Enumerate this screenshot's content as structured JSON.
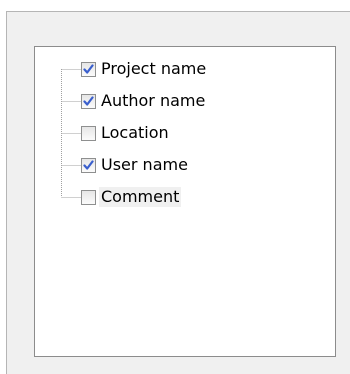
{
  "tree": {
    "items": [
      {
        "label": "Project name",
        "checked": true,
        "selected": false
      },
      {
        "label": "Author name",
        "checked": true,
        "selected": false
      },
      {
        "label": "Location",
        "checked": false,
        "selected": false
      },
      {
        "label": "User name",
        "checked": true,
        "selected": false
      },
      {
        "label": "Comment",
        "checked": false,
        "selected": true
      }
    ]
  },
  "colors": {
    "checkmark": "#3a5fcd",
    "panel_border": "#8c8c8c",
    "tree_line": "#a0a0a0",
    "window_bg": "#f0f0f0"
  }
}
